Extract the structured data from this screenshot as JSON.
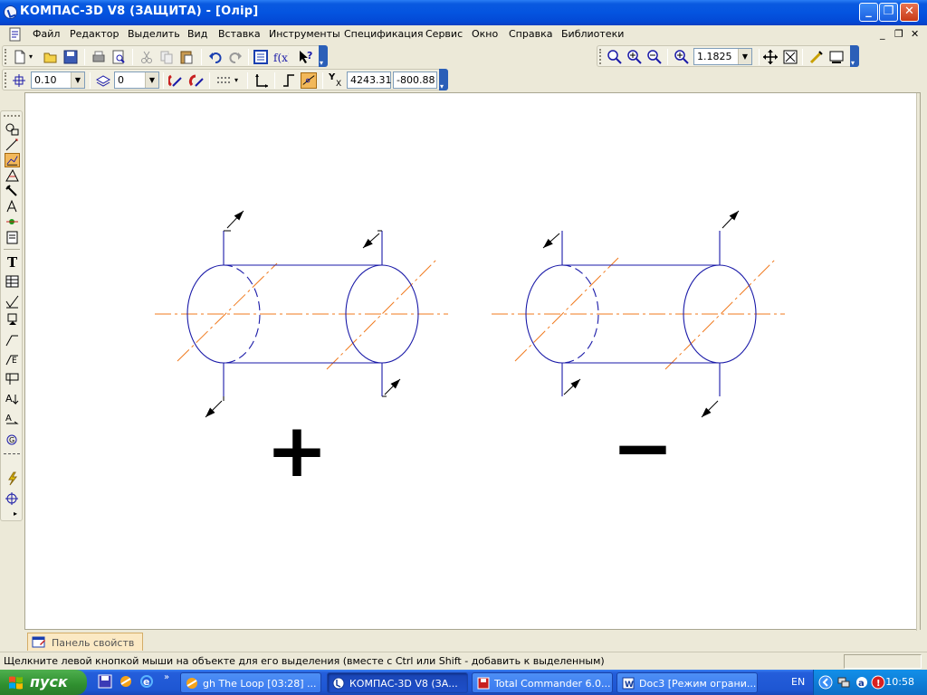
{
  "window": {
    "title": "КОМПАС-3D V8 (ЗАЩИТА) - [Олір]",
    "min_label": "_",
    "max_label": "❐",
    "close_label": "✕"
  },
  "menu": {
    "items": [
      "Файл",
      "Редактор",
      "Выделить",
      "Вид",
      "Вставка",
      "Инструменты",
      "Спецификация",
      "Сервис",
      "Окно",
      "Справка",
      "Библиотеки"
    ],
    "mdi_min": "_",
    "mdi_restore": "❐",
    "mdi_close": "✕"
  },
  "view_toolbar": {
    "zoom_value": "1.1825"
  },
  "current_toolbar": {
    "step_value": "0.10",
    "layer_value": "0",
    "coord_x": "4243.31",
    "coord_y": "-800.88",
    "xy_label": "Y",
    "xy_sub": "X"
  },
  "drawing": {
    "left_sign": "+",
    "right_sign": "−",
    "line_color": "#1a1aa8",
    "axis_color": "#f07a1e"
  },
  "panel": {
    "properties_tab": "Панель свойств"
  },
  "status": {
    "message": "Щелкните левой кнопкой мыши на объекте для его выделения (вместе с Ctrl или Shift - добавить к выделенным)"
  },
  "taskbar": {
    "start_label": "пуск",
    "quicklaunch_more": "»",
    "tasks": [
      {
        "label": "gh The Loop [03:28] ..."
      },
      {
        "label": "КОМПАС-3D V8 (ЗА..."
      },
      {
        "label": "Total Commander 6.0..."
      },
      {
        "label": "Doc3 [Режим ограни..."
      }
    ],
    "lang": "EN",
    "clock": "10:58"
  }
}
